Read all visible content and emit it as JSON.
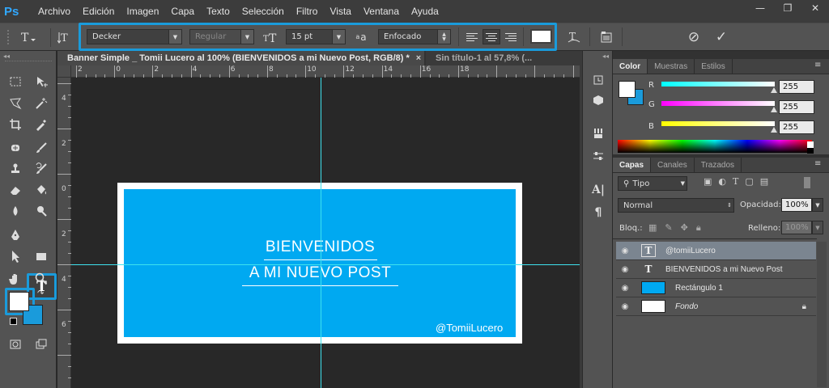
{
  "app": {
    "logo": "Ps"
  },
  "menu": [
    "Archivo",
    "Edición",
    "Imagen",
    "Capa",
    "Texto",
    "Selección",
    "Filtro",
    "Vista",
    "Ventana",
    "Ayuda"
  ],
  "window_controls": {
    "minimize": "—",
    "restore": "❐",
    "close": "✕"
  },
  "options": {
    "font_family": "Decker",
    "font_style": "Regular",
    "font_size": "15 pt",
    "antialias_icon": "a",
    "antialias": "Enfocado",
    "text_color": "#ffffff",
    "cancel_icon": "⊘",
    "commit_icon": "✓"
  },
  "tabs": [
    {
      "label": "Banner Simple _ Tomii Lucero al 100% (BIENVENIDOS a mi Nuevo Post, RGB/8) *",
      "close": "×"
    },
    {
      "label": "Sin título-1 al 57,8% (...",
      "close": ""
    }
  ],
  "rulers": {
    "horizontal": [
      "2",
      "0",
      "2",
      "4",
      "6",
      "8",
      "10",
      "12",
      "14",
      "16",
      "18"
    ],
    "vertical": [
      "4",
      "2",
      "0",
      "2",
      "4",
      "6"
    ]
  },
  "canvas": {
    "line1": "BIENVENIDOS",
    "line2": "A MI NUEVO POST",
    "handle": "@TomiiLucero",
    "banner_color": "#00a9f1"
  },
  "color_panel": {
    "tabs": [
      "Color",
      "Muestras",
      "Estilos"
    ],
    "r_label": "R",
    "r_value": "255",
    "g_label": "G",
    "g_value": "255",
    "b_label": "B",
    "b_value": "255"
  },
  "layers_panel": {
    "tabs": [
      "Capas",
      "Canales",
      "Trazados"
    ],
    "filter_label": "Tipo",
    "blend_mode": "Normal",
    "opacity_label": "Opacidad:",
    "opacity": "100%",
    "lock_label": "Bloq.:",
    "fill_label": "Relleno:",
    "fill": "100%",
    "layers": [
      {
        "name": "@tomiiLucero",
        "type": "text",
        "selected": true
      },
      {
        "name": "BIENVENIDOS a mi Nuevo Post",
        "type": "text",
        "selected": false
      },
      {
        "name": "Rectángulo 1",
        "type": "shape",
        "selected": false
      },
      {
        "name": "Fondo",
        "type": "background",
        "selected": false
      }
    ]
  },
  "colors": {
    "accent": "#1a9bdb",
    "guide": "#3ee2ee",
    "foreground": "#ffffff",
    "background": "#1a9bdb"
  }
}
